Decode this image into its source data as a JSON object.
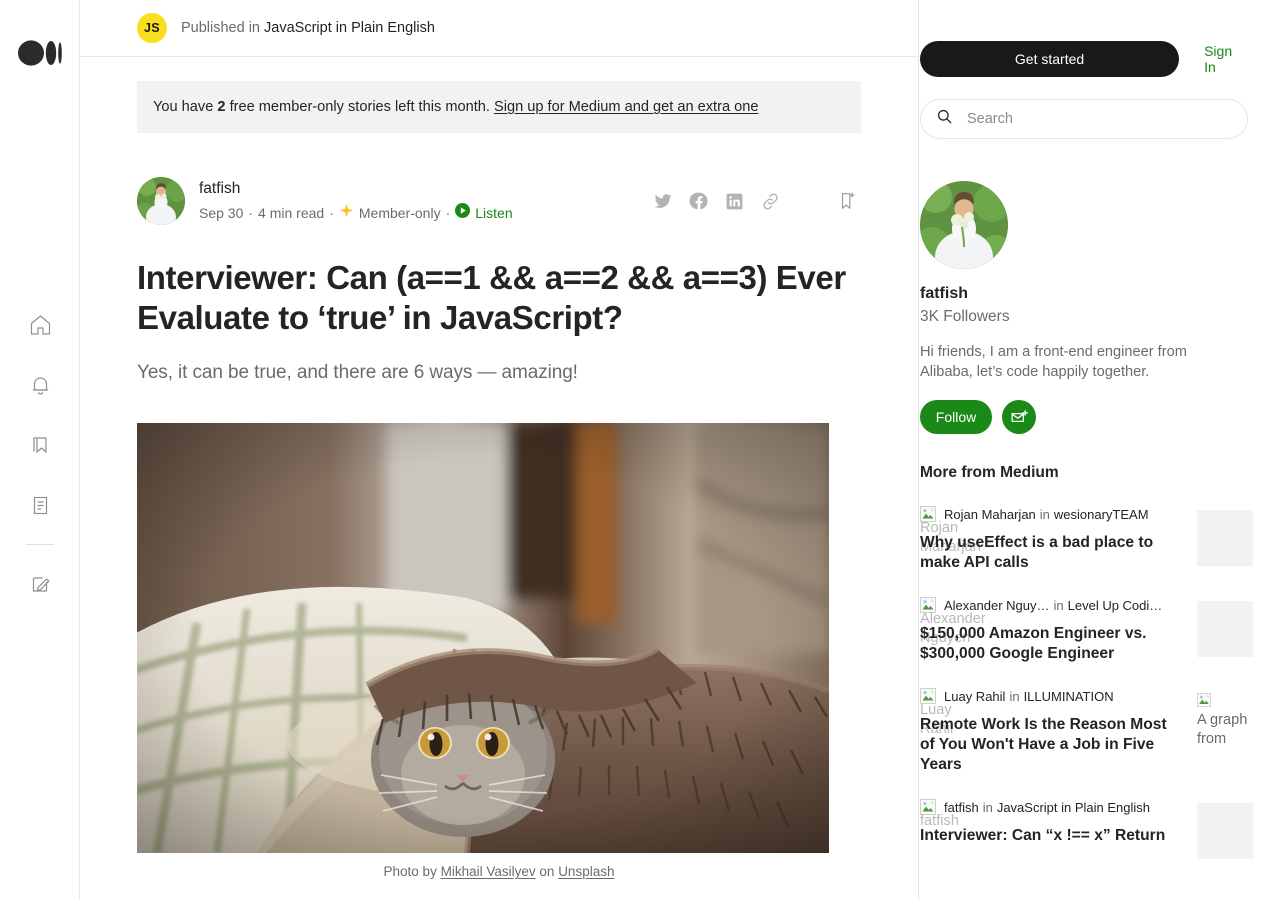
{
  "brand": {
    "logo_name": "medium-logo"
  },
  "left_rail": {
    "items": [
      {
        "icon": "home-icon",
        "label": "Home"
      },
      {
        "icon": "bell-icon",
        "label": "Notifications"
      },
      {
        "icon": "bookmark-icon",
        "label": "Lists"
      },
      {
        "icon": "reading-list-icon",
        "label": "Stories"
      },
      {
        "icon": "write-pencil-icon",
        "label": "Write"
      }
    ]
  },
  "publication_header": {
    "badge_text": "JS",
    "badge_color": "#F7DF1E",
    "prefix": "Published in",
    "publication": "JavaScript in Plain English"
  },
  "member_banner": {
    "prefix": "You have",
    "count": "2",
    "middle": "free member-only stories left this month.",
    "link": "Sign up for Medium and get an extra one"
  },
  "byline": {
    "author": "fatfish",
    "date": "Sep 30",
    "read_time": "4 min read",
    "member_only": "Member-only",
    "listen": "Listen",
    "separator": "·",
    "actions": [
      {
        "icon": "twitter-icon",
        "label": "Share on Twitter"
      },
      {
        "icon": "facebook-icon",
        "label": "Share on Facebook"
      },
      {
        "icon": "linkedin-icon",
        "label": "Share on LinkedIn"
      },
      {
        "icon": "link-icon",
        "label": "Copy link"
      },
      {
        "icon": "bookmark-add-icon",
        "label": "Save"
      }
    ]
  },
  "article": {
    "title": "Interviewer: Can (a==1 && a==2 && a==3) Ever Evaluate to ‘true’ in JavaScript?",
    "subtitle": "Yes, it can be true, and there are 6 ways — amazing!",
    "caption_prefix": "Photo by",
    "caption_author": "Mikhail Vasilyev",
    "caption_on": "on",
    "caption_source": "Unsplash"
  },
  "sidebar": {
    "get_started": "Get started",
    "sign_in": "Sign In",
    "search_placeholder": "Search",
    "search_value": "",
    "profile": {
      "name": "fatfish",
      "followers": "3K Followers",
      "bio": "Hi friends, I am a front-end engineer from Alibaba, let’s code happily together.",
      "follow_label": "Follow",
      "mail_icon": "mail-subscribe-icon"
    },
    "more_title": "More from Medium",
    "stories": [
      {
        "author": "Rojan Maharjan",
        "in": "in",
        "publication": "wesionaryTEAM",
        "title": "Why useEffect is a bad place to make API calls",
        "avatar_alt": "Rojan\nMaharjan",
        "thumb_alt": ""
      },
      {
        "author": "Alexander Nguy…",
        "in": "in",
        "publication": "Level Up Codi…",
        "title": "$150,000 Amazon Engineer vs. $300,000 Google Engineer",
        "avatar_alt": "Alexander\nNguyen",
        "thumb_alt": ""
      },
      {
        "author": "Luay Rahil",
        "in": "in",
        "publication": "ILLUMINATION",
        "title": "Remote Work Is the Reason Most of You Won't Have a Job in Five Years",
        "avatar_alt": "Luay\nRahil",
        "thumb_alt": "A graph from Brookin"
      },
      {
        "author": "fatfish",
        "in": "in",
        "publication": "JavaScript in Plain English",
        "title": "Interviewer: Can “x !== x” Return",
        "avatar_alt": "fatfish",
        "thumb_alt": ""
      }
    ]
  },
  "colors": {
    "accent_green": "#1a8917",
    "brand_black": "#191919",
    "muted": "#6b6b6b",
    "banner_bg": "#f2f2f2",
    "js_yellow": "#F7DF1E"
  }
}
